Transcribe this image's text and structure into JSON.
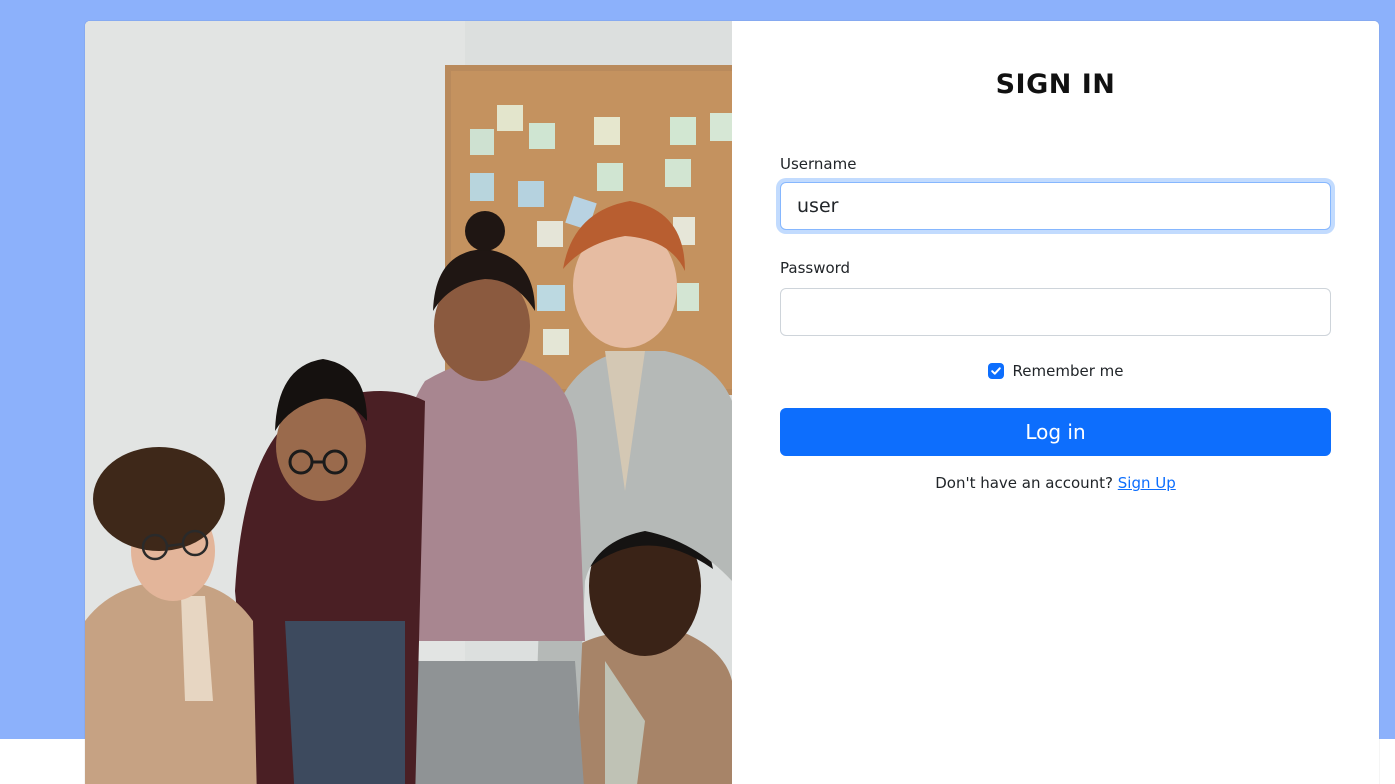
{
  "form": {
    "title": "SIGN IN",
    "username_label": "Username",
    "username_value": "user",
    "password_label": "Password",
    "password_value": "",
    "remember_label": "Remember me",
    "remember_checked": true,
    "login_label": "Log in",
    "signup_prompt": "Don't have an account? ",
    "signup_link": "Sign Up"
  },
  "colors": {
    "page_background": "#8cb1fb",
    "primary": "#0d6efd",
    "focus_border": "#86b7fe"
  }
}
